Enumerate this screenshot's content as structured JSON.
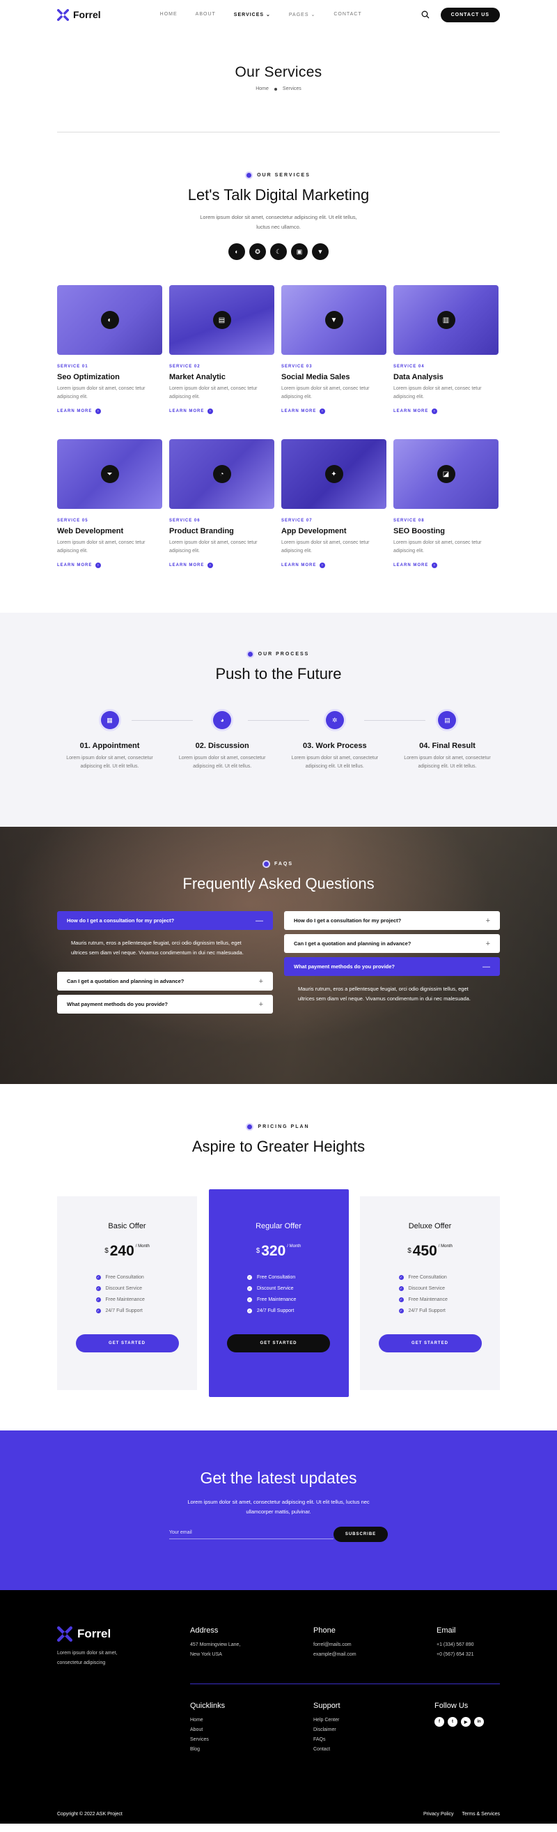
{
  "brand": {
    "name": "Forrel",
    "accent": "#4b39e0"
  },
  "nav": {
    "items": [
      {
        "label": "HOME"
      },
      {
        "label": "ABOUT"
      },
      {
        "label": "SERVICES"
      },
      {
        "label": "PAGES"
      },
      {
        "label": "CONTACT"
      }
    ],
    "cta": "CONTACT US"
  },
  "page": {
    "title": "Our Services",
    "crumb_home": "Home",
    "crumb_current": "Services"
  },
  "services": {
    "eyebrow": "OUR SERVICES",
    "heading": "Let's Talk Digital Marketing",
    "lead": "Lorem ipsum dolor sit amet, consectetur adipiscing elit. Ut elit tellus, luctus nec ullamco.",
    "more_label": "LEARN MORE",
    "cards": [
      {
        "tag": "SERVICE 01",
        "title": "Seo Optimization",
        "text": "Lorem ipsum dolor sit amet, consec tetur adipiscing elit."
      },
      {
        "tag": "SERVICE 02",
        "title": "Market Analytic",
        "text": "Lorem ipsum dolor sit amet, consec tetur adipiscing elit."
      },
      {
        "tag": "SERVICE 03",
        "title": "Social Media Sales",
        "text": "Lorem ipsum dolor sit amet, consec tetur adipiscing elit."
      },
      {
        "tag": "SERVICE 04",
        "title": "Data Analysis",
        "text": "Lorem ipsum dolor sit amet, consec tetur adipiscing elit."
      },
      {
        "tag": "SERVICE 05",
        "title": "Web Development",
        "text": "Lorem ipsum dolor sit amet, consec tetur adipiscing elit."
      },
      {
        "tag": "SERVICE 06",
        "title": "Product Branding",
        "text": "Lorem ipsum dolor sit amet, consec tetur adipiscing elit."
      },
      {
        "tag": "SERVICE 07",
        "title": "App Development",
        "text": "Lorem ipsum dolor sit amet, consec tetur adipiscing elit."
      },
      {
        "tag": "SERVICE 08",
        "title": "SEO Boosting",
        "text": "Lorem ipsum dolor sit amet, consec tetur adipiscing elit."
      }
    ]
  },
  "process": {
    "eyebrow": "OUR PROCESS",
    "heading": "Push to the Future",
    "steps": [
      {
        "title": "01. Appointment",
        "text": "Lorem ipsum dolor sit amet, consectetur adipiscing elit. Ut elit tellus."
      },
      {
        "title": "02. Discussion",
        "text": "Lorem ipsum dolor sit amet, consectetur adipiscing elit. Ut elit tellus."
      },
      {
        "title": "03. Work Process",
        "text": "Lorem ipsum dolor sit amet, consectetur adipiscing elit. Ut elit tellus."
      },
      {
        "title": "04. Final Result",
        "text": "Lorem ipsum dolor sit amet, consectetur adipiscing elit. Ut elit tellus."
      }
    ]
  },
  "faq": {
    "eyebrow": "FAQS",
    "heading": "Frequently Asked Questions",
    "left": [
      {
        "q": "How do I get a consultation for my project?",
        "open": true,
        "a": "Mauris rutrum, eros a pellentesque feugiat, orci odio dignissim tellus, eget ultrices sem diam vel neque. Vivamus condimentum in dui nec malesuada."
      },
      {
        "q": "Can I get a quotation and planning in advance?",
        "open": false
      },
      {
        "q": "What payment methods do you provide?",
        "open": false
      }
    ],
    "right": [
      {
        "q": "How do I get a consultation for my project?",
        "open": false
      },
      {
        "q": "Can I get a quotation and planning in advance?",
        "open": false
      },
      {
        "q": "What payment methods do you provide?",
        "open": true,
        "a": "Mauris rutrum, eros a pellentesque feugiat, orci odio dignissim tellus, eget ultrices sem diam vel neque. Vivamus condimentum in dui nec malesuada."
      }
    ]
  },
  "pricing": {
    "eyebrow": "PRICING PLAN",
    "heading": "Aspire to Greater Heights",
    "currency": "$",
    "period": "/ Month",
    "button": "GET STARTED",
    "plans": [
      {
        "name": "Basic Offer",
        "price": "240",
        "featured": false,
        "features": [
          "Free Consultation",
          "Discount Service",
          "Free Maintenance",
          "24/7 Full Support"
        ]
      },
      {
        "name": "Regular Offer",
        "price": "320",
        "featured": true,
        "features": [
          "Free Consultation",
          "Discount Service",
          "Free Maintenance",
          "24/7 Full Support"
        ]
      },
      {
        "name": "Deluxe Offer",
        "price": "450",
        "featured": false,
        "features": [
          "Free Consultation",
          "Discount Service",
          "Free Maintenance",
          "24/7 Full Support"
        ]
      }
    ]
  },
  "newsletter": {
    "heading": "Get the latest updates",
    "text": "Lorem ipsum dolor sit amet, consectetur adipiscing elit. Ut elit tellus, luctus nec ullamcorper mattis, pulvinar.",
    "placeholder": "Your email",
    "button": "SUBSCRIBE"
  },
  "footer": {
    "desc": "Lorem ipsum dolor sit amet, consectetur adipiscing",
    "address": {
      "title": "Address",
      "lines": [
        "457 Morningview Lane,",
        "New York USA"
      ]
    },
    "phone": {
      "title": "Phone",
      "lines": [
        "forrel@mails.com",
        "example@mail.com"
      ]
    },
    "email": {
      "title": "Email",
      "lines": [
        "+1 (334) 567 890",
        "+0 (567) 654 321"
      ]
    },
    "quicklinks": {
      "title": "Quicklinks",
      "links": [
        "Home",
        "About",
        "Services",
        "Blog"
      ]
    },
    "support": {
      "title": "Support",
      "links": [
        "Help Center",
        "Disclaimer",
        "FAQs",
        "Contact"
      ]
    },
    "follow": {
      "title": "Follow Us",
      "icons": [
        "facebook-icon",
        "twitter-icon",
        "youtube-icon",
        "linkedin-icon"
      ]
    },
    "copyright": "Copyright © 2022 ASK Project",
    "privacy": "Privacy Policy",
    "terms": "Terms & Services"
  }
}
